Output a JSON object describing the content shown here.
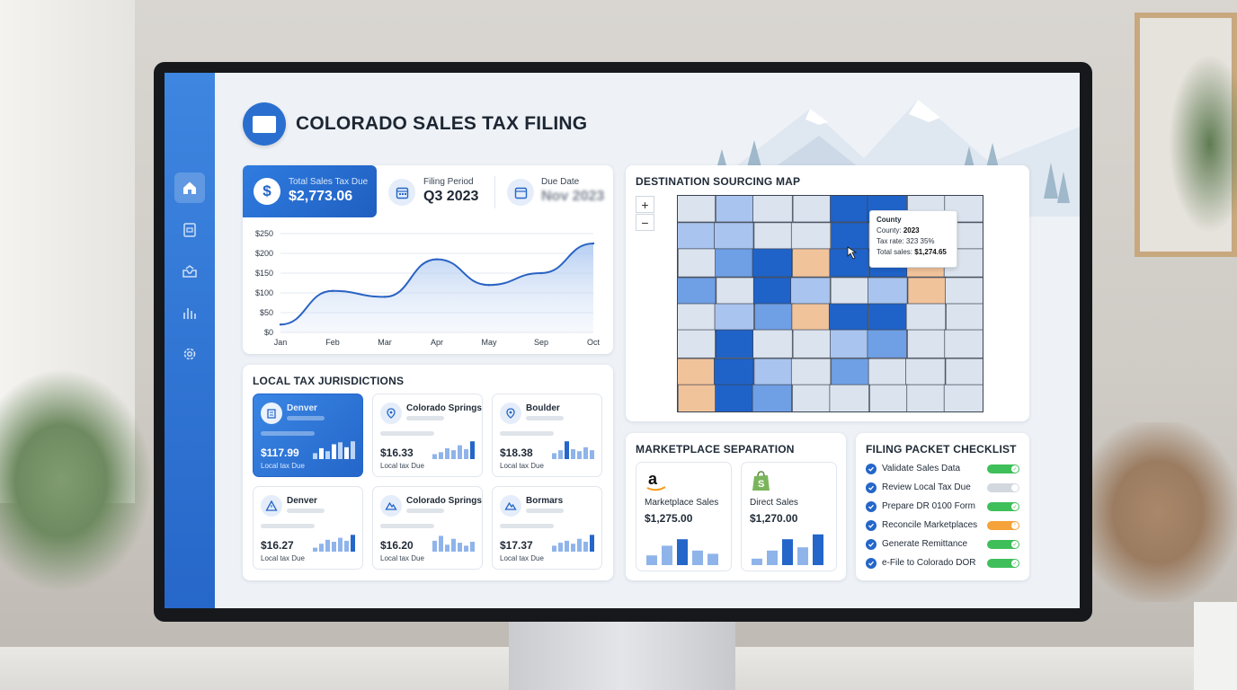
{
  "app": {
    "title": "COLORADO SALES TAX FILING"
  },
  "sidebar": {
    "items": [
      {
        "icon": "home-icon",
        "active": true
      },
      {
        "icon": "document-icon",
        "active": false
      },
      {
        "icon": "inbox-icon",
        "active": false
      },
      {
        "icon": "bar-chart-icon",
        "active": false
      },
      {
        "icon": "gear-icon",
        "active": false
      }
    ]
  },
  "summary": {
    "total_label": "Total Sales Tax Due",
    "total_value": "$2,773.06",
    "period_label": "Filing Period",
    "period_value": "Q3 2023",
    "due_label": "Due Date",
    "due_value": "Nov 2023"
  },
  "chart_data": {
    "type": "line",
    "categories": [
      "Jan",
      "Feb",
      "Mar",
      "Apr",
      "May",
      "Sep",
      "Oct"
    ],
    "values": [
      20,
      105,
      90,
      185,
      120,
      150,
      225
    ],
    "ylim": [
      0,
      250
    ],
    "yticks": [
      "$0",
      "$50",
      "$100",
      "$150",
      "$200",
      "$250"
    ],
    "ytick_values": [
      0,
      50,
      100,
      150,
      200,
      250
    ],
    "grid": true,
    "color": "#2a63c4"
  },
  "jurisdictions": {
    "title": "LOCAL TAX JURISDICTIONS",
    "sub_label": "Local tax Due",
    "tiles": [
      {
        "name": "Denver",
        "amount": "$117.99",
        "sub": "Local tax Due",
        "icon": "building-icon",
        "active": true,
        "bars": [
          0.3,
          0.55,
          0.4,
          0.75,
          0.85,
          0.6,
          0.9
        ]
      },
      {
        "name": "Colorado Springs",
        "amount": "$16.33",
        "sub": "Local tax Due",
        "icon": "map-pin-icon",
        "active": false,
        "bars": [
          0.25,
          0.35,
          0.55,
          0.45,
          0.7,
          0.5,
          0.9
        ]
      },
      {
        "name": "Boulder",
        "amount": "$18.38",
        "sub": "Local tax Due",
        "icon": "map-pin-icon",
        "active": false,
        "bars": [
          0.3,
          0.45,
          0.9,
          0.5,
          0.4,
          0.6,
          0.45
        ]
      },
      {
        "name": "Denver",
        "amount": "$16.27",
        "sub": "Local tax Due",
        "icon": "warning-icon",
        "active": false,
        "bars": [
          0.2,
          0.4,
          0.6,
          0.5,
          0.7,
          0.55,
          0.85
        ]
      },
      {
        "name": "Colorado Springs",
        "amount": "$16.20",
        "sub": "Local tax Due",
        "icon": "mountain-icon",
        "active": false,
        "bars": [
          0.55,
          0.8,
          0.35,
          0.65,
          0.45,
          0.3,
          0.5
        ]
      },
      {
        "name": "Bormars",
        "amount": "$17.37",
        "sub": "Local tax Due",
        "icon": "mountain-icon",
        "active": false,
        "bars": [
          0.3,
          0.45,
          0.55,
          0.4,
          0.65,
          0.5,
          0.85
        ]
      }
    ]
  },
  "map": {
    "title": "DESTINATION SOURCING MAP",
    "zoom_in": "+",
    "zoom_out": "−",
    "tooltip": {
      "title": "County",
      "county_label": "County:",
      "county_value": "2023",
      "rate_label": "Tax rate:",
      "rate_value": "323 35%",
      "sales_label": "Total sales:",
      "sales_value": "$1,274.65"
    },
    "colors": {
      "dark": "#1f63c9",
      "medium": "#6f9fe4",
      "light": "#a9c4ee",
      "pale": "#dbe3ee",
      "orange": "#f1c39b",
      "border": "#3a4250"
    }
  },
  "marketplace": {
    "title": "MARKETPLACE SEPARATION",
    "items": [
      {
        "name": "Marketplace Sales",
        "value": "$1,275.00",
        "icon": "amazon-icon",
        "bars": [
          0.3,
          0.6,
          0.8,
          0.45,
          0.35
        ]
      },
      {
        "name": "Direct Sales",
        "value": "$1,270.00",
        "icon": "shopify-icon",
        "bars": [
          0.2,
          0.45,
          0.8,
          0.55,
          0.95
        ]
      }
    ]
  },
  "checklist": {
    "title": "FILING PACKET CHECKLIST",
    "items": [
      {
        "label": "Validate Sales Data",
        "status": "done",
        "color": "#3fbf5a"
      },
      {
        "label": "Review Local Tax Due",
        "status": "pending",
        "color": "#d3d8df"
      },
      {
        "label": "Prepare DR 0100 Form",
        "status": "done",
        "color": "#3fbf5a"
      },
      {
        "label": "Reconcile Marketplaces",
        "status": "warning",
        "color": "#f5a23a"
      },
      {
        "label": "Generate Remittance",
        "status": "done",
        "color": "#3fbf5a"
      },
      {
        "label": "e-File to Colorado DOR",
        "status": "done",
        "color": "#3fbf5a"
      }
    ]
  }
}
